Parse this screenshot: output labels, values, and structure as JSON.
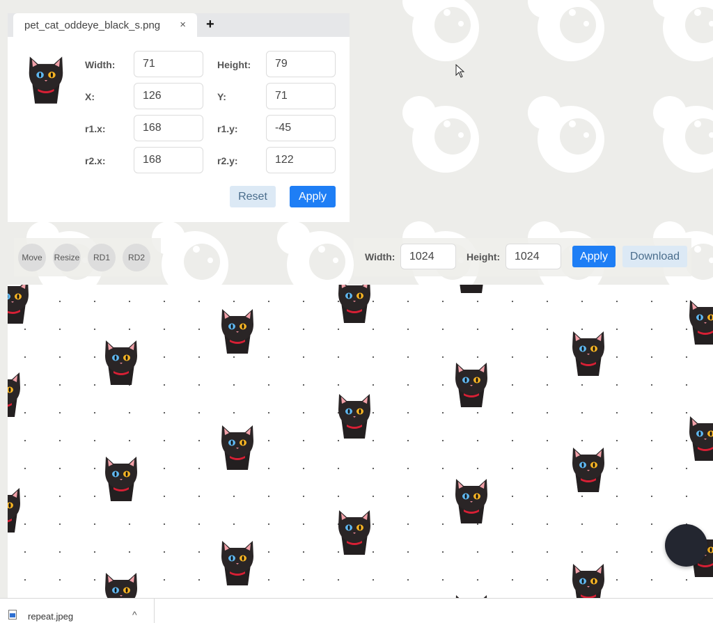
{
  "editor": {
    "tab_filename": "pet_cat_oddeye_black_s.png",
    "tab_close": "×",
    "tab_add": "+",
    "fields": {
      "width": {
        "label": "Width:",
        "value": "71"
      },
      "height": {
        "label": "Height:",
        "value": "79"
      },
      "x": {
        "label": "X:",
        "value": "126"
      },
      "y": {
        "label": "Y:",
        "value": "71"
      },
      "r1x": {
        "label": "r1.x:",
        "value": "168"
      },
      "r1y": {
        "label": "r1.y:",
        "value": "-45"
      },
      "r2x": {
        "label": "r2.x:",
        "value": "168"
      },
      "r2y": {
        "label": "r2.y:",
        "value": "122"
      }
    },
    "reset_label": "Reset",
    "apply_label": "Apply"
  },
  "tools": {
    "move": "Move",
    "resize": "Resize",
    "rd1": "RD1",
    "rd2": "RD2"
  },
  "canvas_size": {
    "width_label": "Width:",
    "width_value": "1024",
    "height_label": "Height:",
    "height_value": "1024",
    "apply_label": "Apply",
    "download_label": "Download"
  },
  "download_bar": {
    "filename": "repeat.jpeg",
    "chevron": "^"
  },
  "colors": {
    "primary": "#1e7ef5",
    "light_button": "#dce9f5",
    "background": "#ededea",
    "fab": "#232630"
  }
}
